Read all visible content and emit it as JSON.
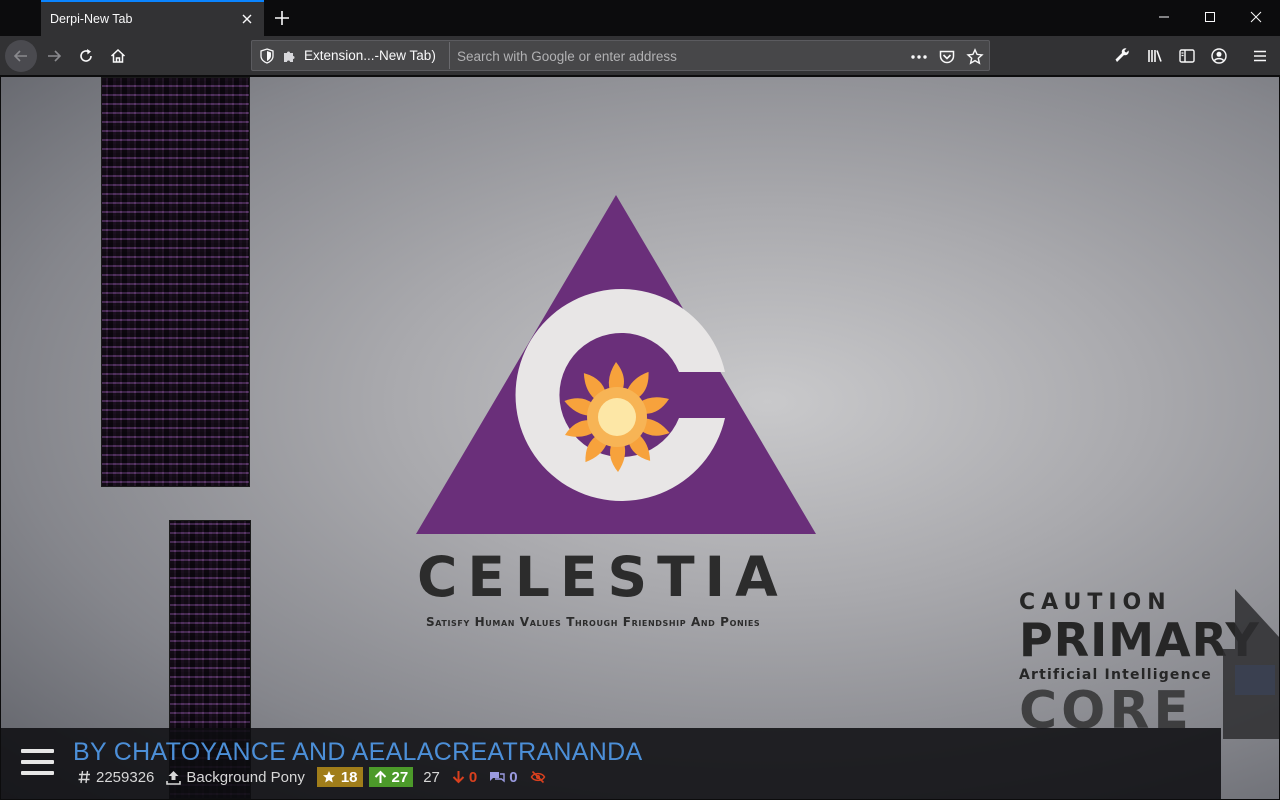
{
  "browser": {
    "tab": {
      "title": "Derpi-New Tab"
    },
    "urlbar": {
      "extension_label": "Extension...-New Tab)",
      "placeholder": "Search with Google or enter address"
    }
  },
  "image": {
    "brand_text": "CELESTIA",
    "tagline": "Satisfy Human Values Through Friendship And Ponies",
    "sign": {
      "line1": "CAUTION",
      "line2": "PRIMARY",
      "line3": "Artificial Intelligence",
      "line4": "CORE"
    }
  },
  "info": {
    "artist": "BY CHATOYANCE AND AEALACREATRANANDA",
    "id": "2259326",
    "uploader": "Background Pony",
    "faves": "18",
    "upvotes": "27",
    "score": "27",
    "downvotes": "0",
    "comments": "0"
  },
  "colors": {
    "accent": "#0a84ff",
    "link": "#4c8fd8",
    "fave": "#a07d1a",
    "upvote": "#4c9a2a",
    "downvote": "#d9401e",
    "logo_purple": "#6a2f7a"
  }
}
